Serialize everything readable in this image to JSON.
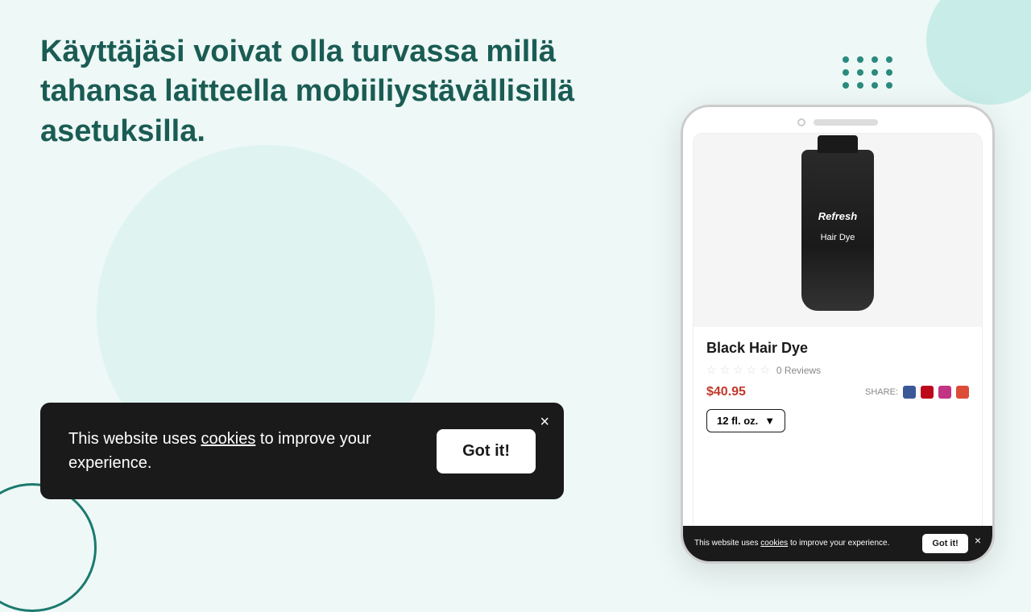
{
  "page": {
    "background_color": "#eef8f6"
  },
  "heading": {
    "text": "Käyttäjäsi voivat olla turvassa millä tahansa laitteella mobiiliystävällisillä asetuksilla."
  },
  "cookie_banner_large": {
    "message_prefix": "This website uses ",
    "link_text": "cookies",
    "message_suffix": " to improve your experience.",
    "got_it_label": "Got it!",
    "close_symbol": "×"
  },
  "cookie_banner_small": {
    "message_prefix": "This website uses ",
    "link_text": "cookies",
    "message_suffix": " to improve your experience.",
    "got_it_label": "Got it!",
    "close_symbol": "×"
  },
  "product": {
    "brand": "Refresh",
    "name": "Black Hair Dye",
    "type": "Hair Dye",
    "price": "$40.95",
    "reviews": "0 Reviews",
    "size": "12 fl. oz.",
    "share_label": "SHARE:"
  }
}
